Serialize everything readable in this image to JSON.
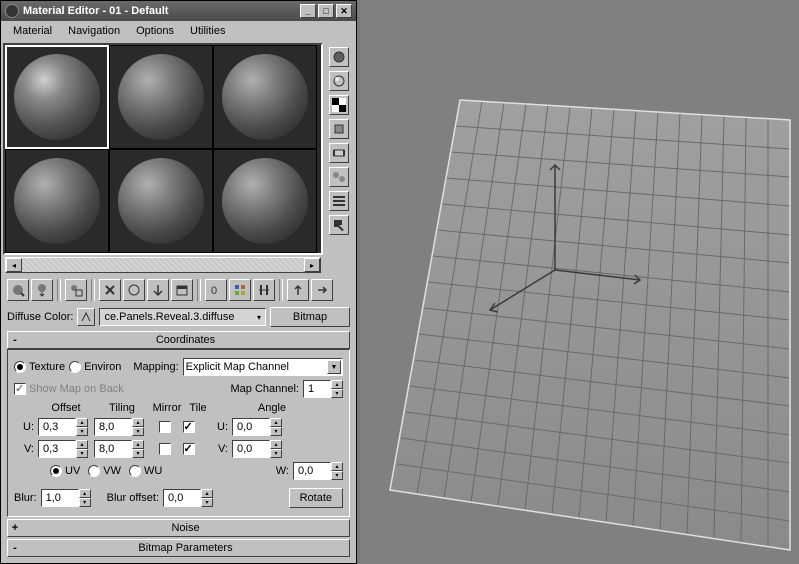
{
  "window": {
    "title": "Material Editor - 01 - Default",
    "menus": [
      "Material",
      "Navigation",
      "Options",
      "Utilities"
    ]
  },
  "diffuse": {
    "label": "Diffuse Color:",
    "map_name": "ce.Panels.Reveal.3.diffuse",
    "type_btn": "Bitmap"
  },
  "coordinates": {
    "title": "Coordinates",
    "texture": "Texture",
    "environ": "Environ",
    "mapping_label": "Mapping:",
    "mapping_value": "Explicit Map Channel",
    "show_map": "Show Map on Back",
    "map_channel_label": "Map Channel:",
    "map_channel": "1",
    "headers": {
      "offset": "Offset",
      "tiling": "Tiling",
      "mirror": "Mirror",
      "tile": "Tile",
      "angle": "Angle"
    },
    "u": {
      "label": "U:",
      "offset": "0,3",
      "tiling": "8,0",
      "angle": "0,0"
    },
    "v": {
      "label": "V:",
      "offset": "0,3",
      "tiling": "8,0",
      "angle": "0,0"
    },
    "w_angle": {
      "label": "W:",
      "value": "0,0"
    },
    "uv": "UV",
    "vw": "VW",
    "wu": "WU",
    "blur_label": "Blur:",
    "blur": "1,0",
    "bluroff_label": "Blur offset:",
    "bluroff": "0,0",
    "rotate": "Rotate"
  },
  "noise": {
    "title": "Noise"
  },
  "bitmap_params": {
    "title": "Bitmap Parameters"
  }
}
